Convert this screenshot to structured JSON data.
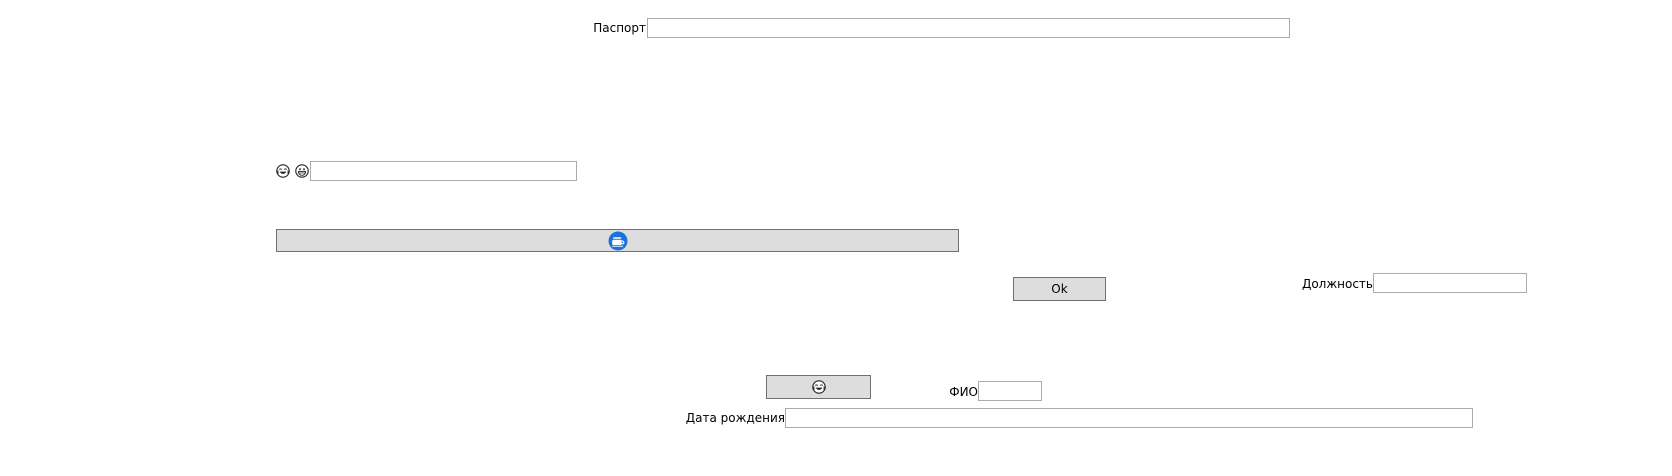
{
  "form": {
    "passport_label": "Паспорт",
    "position_label": "Должность",
    "fio_label": "ФИО",
    "birthdate_label": "Дата рождения",
    "ok_button_label": "Ok",
    "passport_value": "",
    "position_value": "",
    "fio_value": "",
    "birthdate_value": "",
    "emoji_field_value": ""
  },
  "icons": {
    "laughing_face": "face-with-tears-of-joy-icon",
    "grinning_face": "grinning-face-icon",
    "wide_button_icon": "blue-circle-logo-icon",
    "small_button_icon": "face-with-tears-of-joy-icon"
  },
  "colors": {
    "button_bg": "#dddddd",
    "button_border": "#707070",
    "field_border": "#ababab",
    "accent_blue": "#1a73d9"
  }
}
